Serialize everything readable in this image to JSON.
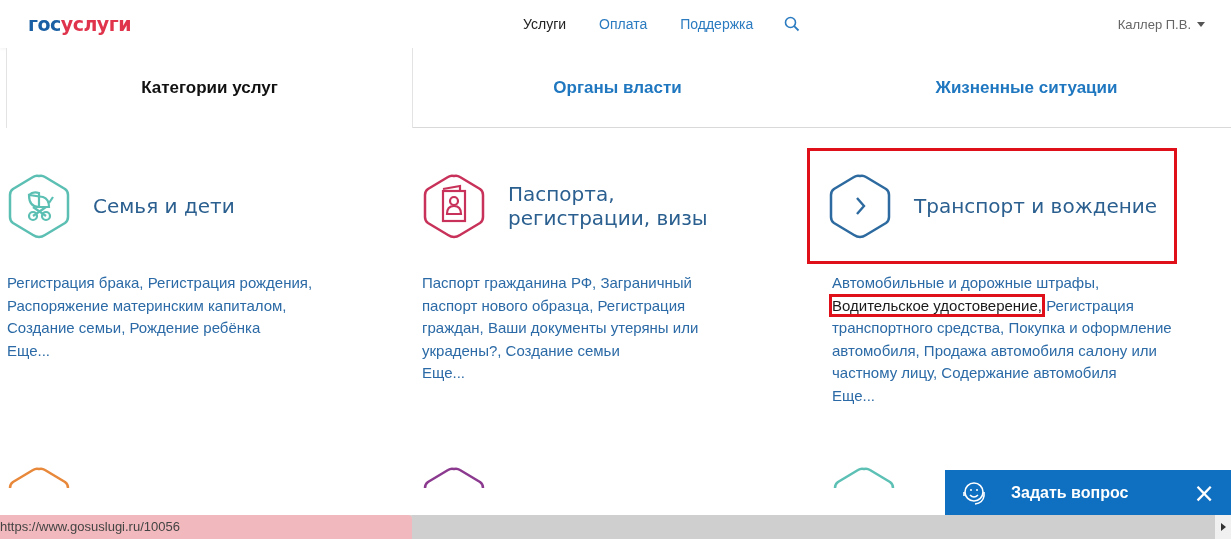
{
  "logo": {
    "first": "гос",
    "second": "услуги"
  },
  "nav": [
    {
      "label": "Услуги",
      "selected": true
    },
    {
      "label": "Оплата",
      "selected": false
    },
    {
      "label": "Поддержка",
      "selected": false
    }
  ],
  "user": {
    "name": "Каллер П.В."
  },
  "tabs": [
    {
      "label": "Категории услуг",
      "selected": true
    },
    {
      "label": "Органы власти",
      "selected": false
    },
    {
      "label": "Жизненные ситуации",
      "selected": false
    }
  ],
  "categories": [
    {
      "kind": "family",
      "title": "Семья и дети",
      "highlighted": false,
      "color": "#5cbfb3",
      "description": [
        {
          "text": "Регистрация брака, Регистрация рождения, Распоряжение материнским капиталом, Создание семьи, Рождение ребёнка",
          "highlighted": false
        }
      ],
      "more": "Еще..."
    },
    {
      "kind": "passport",
      "title": "Паспорта, регистрации, визы",
      "highlighted": false,
      "color": "#c8325a",
      "description": [
        {
          "text": "Паспорт гражданина РФ, Заграничный паспорт нового образца, Регистрация граждан, Ваши документы утеряны или украдены?, Создание семьи",
          "highlighted": false
        }
      ],
      "more": "Еще..."
    },
    {
      "kind": "transport",
      "title": "Транспорт и вождение",
      "highlighted": true,
      "color": "#2d6a9f",
      "description": [
        {
          "text": "Автомобильные и дорожные штрафы, ",
          "highlighted": false
        },
        {
          "text": "Водительское удостоверение,",
          "highlighted": true
        },
        {
          "text": " Регистрация транспортного средства, Покупка и оформление автомобиля, Продажа автомобиля салону или частному лицу, Содержание автомобиля",
          "highlighted": false
        }
      ],
      "more": "Еще..."
    }
  ],
  "next_row": [
    {
      "color": "#e8883a"
    },
    {
      "color": "#8b3a8f"
    },
    {
      "color": "#5cc0b5"
    }
  ],
  "chat": {
    "label": "Задать вопрос",
    "close": "×"
  },
  "status_url": "https://www.gosuslugi.ru/10056"
}
